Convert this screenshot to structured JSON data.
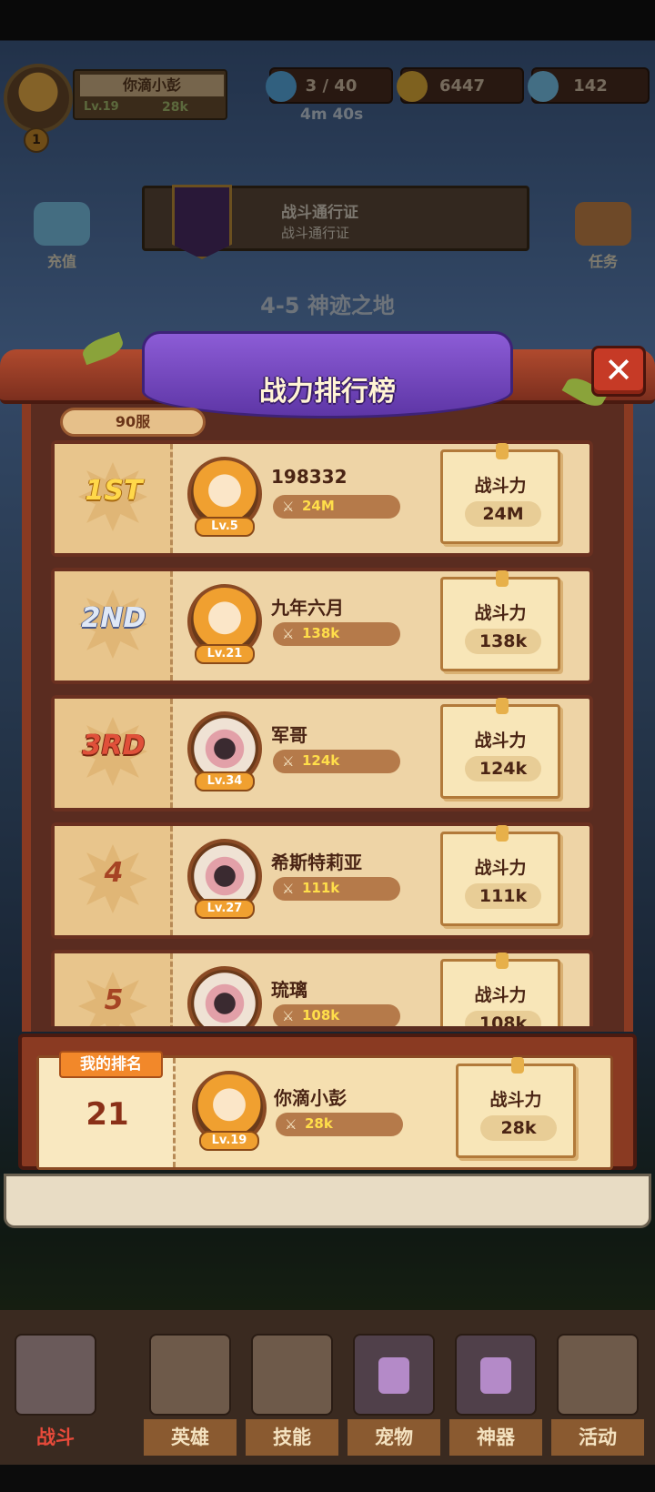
{
  "hud": {
    "player_name": "你滴小彭",
    "level": "Lv.19",
    "power": "28k",
    "vip": "1",
    "stamina": "3 / 40",
    "stamina_timer": "4m 40s",
    "gold": "6447",
    "gems": "142"
  },
  "side": {
    "recharge": "充值",
    "quests": "任务"
  },
  "battle_pass": {
    "title": "战斗通行证",
    "subtitle": "战斗通行证"
  },
  "stage": "4-5 神迹之地",
  "popup": {
    "title": "战力排行榜",
    "close_label": "✕",
    "server": "90服",
    "power_label": "战斗力",
    "rows": [
      {
        "rank": "1ST",
        "name": "198332",
        "level": "Lv.5",
        "power": "24M",
        "score": "24M"
      },
      {
        "rank": "2ND",
        "name": "九年六月",
        "level": "Lv.21",
        "power": "138k",
        "score": "138k"
      },
      {
        "rank": "3RD",
        "name": "军哥",
        "level": "Lv.34",
        "power": "124k",
        "score": "124k"
      },
      {
        "rank": "4",
        "name": "希斯特莉亚",
        "level": "Lv.27",
        "power": "111k",
        "score": "111k"
      },
      {
        "rank": "5",
        "name": "琉璃",
        "level": "",
        "power": "108k",
        "score": "108k"
      }
    ],
    "my_rank": {
      "tag": "我的排名",
      "rank": "21",
      "name": "你滴小彭",
      "level": "Lv.19",
      "power": "28k",
      "score": "28k"
    }
  },
  "nav": {
    "battle": "战斗",
    "heroes": "英雄",
    "skills": "技能",
    "pets": "宠物",
    "artifacts": "神器",
    "events": "活动"
  },
  "colors": {
    "frame": "#8a3a22",
    "ribbon": "#7a4cc6",
    "row_bg": "#eed4a6",
    "power_value": "#ffde4a"
  }
}
